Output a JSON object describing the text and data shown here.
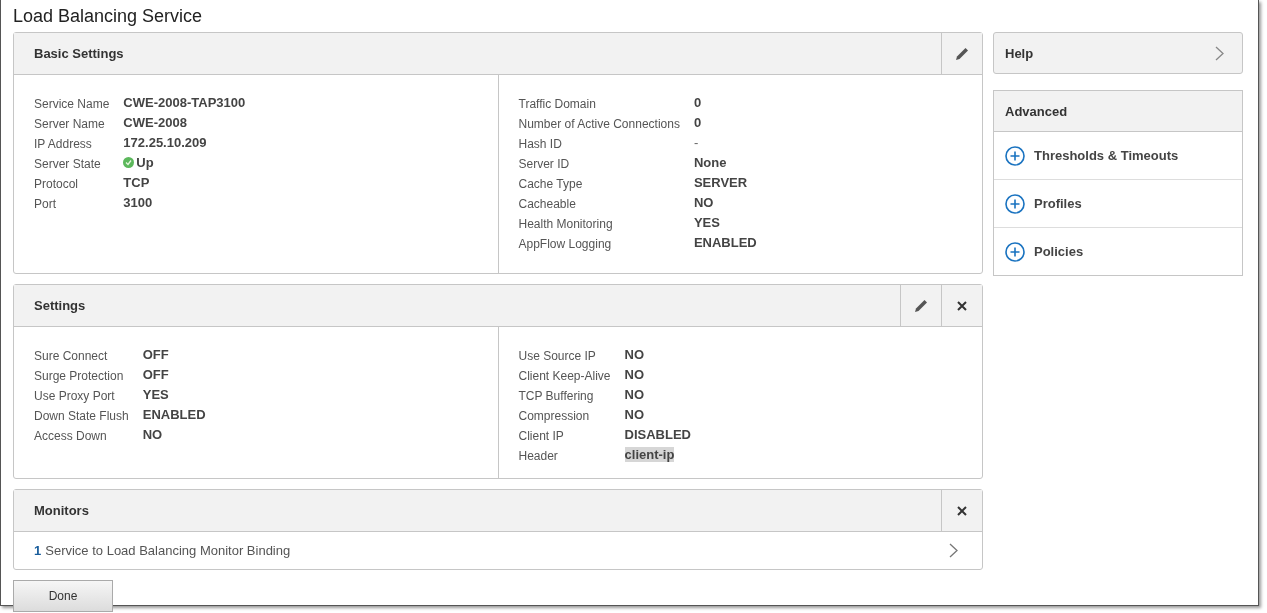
{
  "window": {
    "title": "Load Balancing Service"
  },
  "sections": [
    {
      "title": "Basic Settings",
      "editable": true,
      "closable": false,
      "columns": [
        [
          {
            "label": "Service Name",
            "value": "CWE-2008-TAP3100",
            "kind": "plain"
          },
          {
            "label": "Server Name",
            "value": "CWE-2008",
            "kind": "plain"
          },
          {
            "label": "IP Address",
            "value": "172.25.10.209",
            "kind": "plain"
          },
          {
            "label": "Server State",
            "value": "Up",
            "kind": "status"
          },
          {
            "label": "Protocol",
            "value": "TCP",
            "kind": "plain"
          },
          {
            "label": "Port",
            "value": "3100",
            "kind": "plain"
          }
        ],
        [
          {
            "label": "Traffic Domain",
            "value": "0",
            "kind": "plain"
          },
          {
            "label": "Number of Active Connections",
            "value": "0",
            "kind": "plain"
          },
          {
            "label": "Hash ID",
            "value": "-",
            "kind": "muted"
          },
          {
            "label": "Server ID",
            "value": "None",
            "kind": "plain"
          },
          {
            "label": "Cache Type",
            "value": "SERVER",
            "kind": "plain"
          },
          {
            "label": "Cacheable",
            "value": "NO",
            "kind": "plain"
          },
          {
            "label": "Health Monitoring",
            "value": "YES",
            "kind": "plain"
          },
          {
            "label": "AppFlow Logging",
            "value": "ENABLED",
            "kind": "plain"
          }
        ]
      ]
    },
    {
      "title": "Settings",
      "editable": true,
      "closable": true,
      "columns": [
        [
          {
            "label": "Sure Connect",
            "value": "OFF",
            "kind": "plain"
          },
          {
            "label": "Surge Protection",
            "value": "OFF",
            "kind": "plain"
          },
          {
            "label": "Use Proxy Port",
            "value": "YES",
            "kind": "plain"
          },
          {
            "label": "Down State Flush",
            "value": "ENABLED",
            "kind": "plain"
          },
          {
            "label": "Access Down",
            "value": "NO",
            "kind": "plain"
          }
        ],
        [
          {
            "label": "Use Source IP",
            "value": "NO",
            "kind": "plain"
          },
          {
            "label": "Client Keep-Alive",
            "value": "NO",
            "kind": "plain"
          },
          {
            "label": "TCP Buffering",
            "value": "NO",
            "kind": "plain"
          },
          {
            "label": "Compression",
            "value": "NO",
            "kind": "plain"
          },
          {
            "label": "Client IP",
            "value": "DISABLED",
            "kind": "plain"
          },
          {
            "label": "Header",
            "value": "client-ip",
            "kind": "highlight"
          }
        ]
      ]
    }
  ],
  "monitors": {
    "title": "Monitors",
    "closable": true,
    "bindings": [
      {
        "count": "1",
        "label": "Service to Load Balancing Monitor Binding"
      }
    ]
  },
  "done_button": "Done",
  "help": {
    "title": "Help"
  },
  "advanced": {
    "title": "Advanced",
    "items": [
      "Thresholds & Timeouts",
      "Profiles",
      "Policies"
    ]
  }
}
